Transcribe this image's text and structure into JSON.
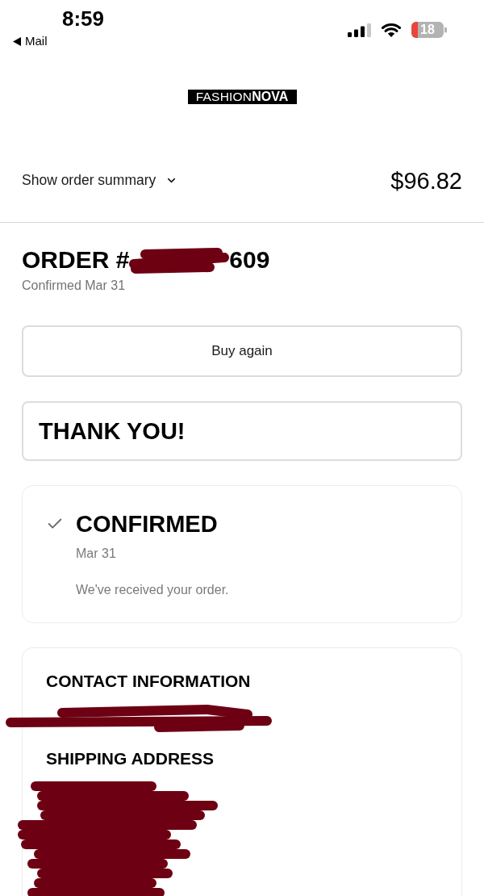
{
  "status_bar": {
    "time": "8:59",
    "back_label": "Mail",
    "battery": "18"
  },
  "logo": {
    "light": "FASHION",
    "bold": "NOVA"
  },
  "summary": {
    "label": "Show order summary",
    "expanded": false,
    "total": "$96.82"
  },
  "order": {
    "prefix": "ORDER #",
    "suffix": "609",
    "redacted": true,
    "confirmed": "Confirmed Mar 31"
  },
  "buy_again": "Buy again",
  "thank_you": "THANK YOU!",
  "status": {
    "title": "CONFIRMED",
    "done": true,
    "date": "Mar 31",
    "message": "We've received your order."
  },
  "sections": [
    {
      "heading": "CONTACT INFORMATION",
      "redacted": true
    },
    {
      "heading": "SHIPPING ADDRESS",
      "redacted": true
    }
  ]
}
